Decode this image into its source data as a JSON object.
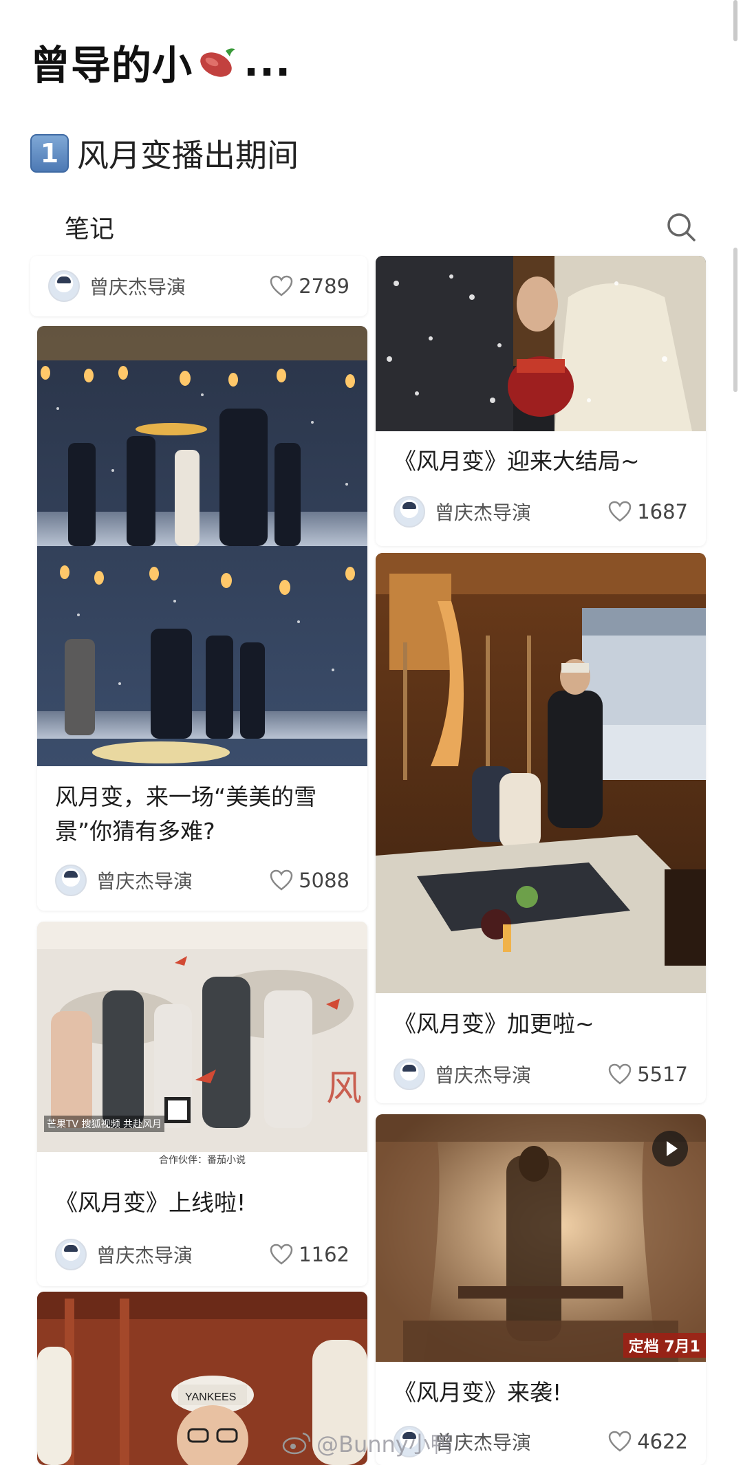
{
  "profile": {
    "title": "曾导的小",
    "emoji_icon": "sweet-potato-icon",
    "title_suffix": "..."
  },
  "collection": {
    "number": "1",
    "title": "风月变播出期间"
  },
  "tabs": {
    "notes_label": "笔记",
    "search_icon": "search-icon"
  },
  "colors": {
    "heart_outline": "#888888",
    "background": "#ffffff",
    "badge": "#4d79b4"
  },
  "notes": [
    {
      "title": "",
      "author": "曾庆杰导演",
      "likes": "2789"
    },
    {
      "title": "风月变，来一场“美美的雪景”你猜有多难?",
      "author": "曾庆杰导演",
      "likes": "5088"
    },
    {
      "title": "《风月变》上线啦!",
      "author": "曾庆杰导演",
      "likes": "1162"
    },
    {
      "title": "《风月变》迎来大结局~",
      "author": "曾庆杰导演",
      "likes": "1687"
    },
    {
      "title": "《风月变》加更啦~",
      "author": "曾庆杰导演",
      "likes": "5517"
    },
    {
      "title": "《风月变》来袭!",
      "author": "曾庆杰导演",
      "likes": "4622"
    }
  ],
  "poster": {
    "footer": "合作伙伴：番茄小说",
    "caption_left": "芒果TV 搜狐视频 共赴风月",
    "date_badge": "定档 7月1"
  },
  "watermark": {
    "text": "@Bunny小鸭"
  }
}
